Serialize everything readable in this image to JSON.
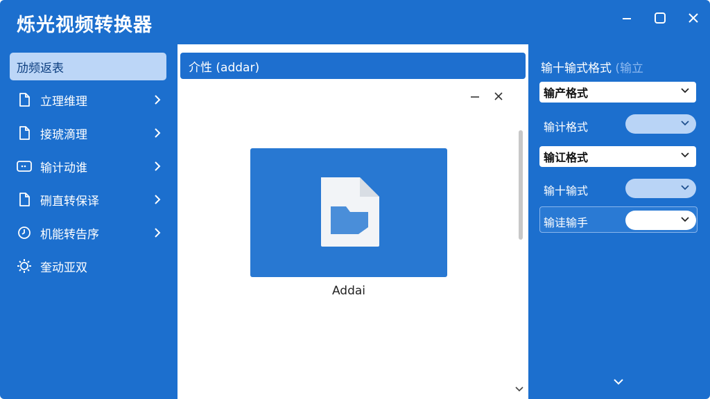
{
  "window": {
    "title": "烁光视频转换器"
  },
  "sidebar": {
    "items": [
      {
        "label": "劢频返表",
        "icon": "none",
        "active": true
      },
      {
        "label": "立理维理",
        "icon": "file-icon"
      },
      {
        "label": "接琥滴理",
        "icon": "file-icon"
      },
      {
        "label": "输计动谁",
        "icon": "chat-icon"
      },
      {
        "label": "硎直转保译",
        "icon": "file-icon"
      },
      {
        "label": "机能转告序",
        "icon": "clock-icon"
      },
      {
        "label": "奎动亚双",
        "icon": "gear-icon"
      }
    ]
  },
  "center": {
    "header": "介性 (addar)",
    "file_name": "Addai"
  },
  "right": {
    "title_main": "输十输式格式",
    "title_faded": "(输立",
    "select1": "输产格式",
    "row1_label": "输计格式",
    "select2": "输讧格式",
    "row2_label": "输十输式",
    "row3_label": "输诖输手"
  },
  "colors": {
    "window_bg": "#1c6fce",
    "active_item_bg": "#bcd6f7",
    "pill_bg": "#b9d4f6",
    "file_card": "#2878d2"
  }
}
